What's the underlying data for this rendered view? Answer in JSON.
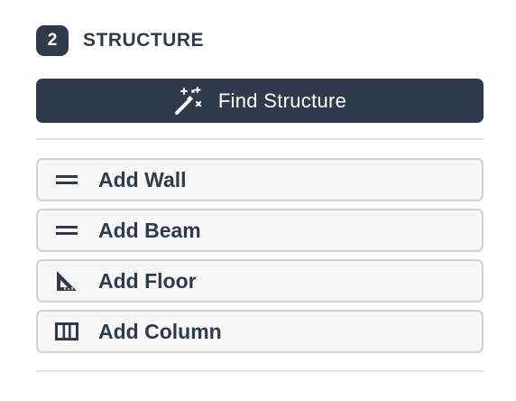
{
  "section": {
    "step_number": "2",
    "title": "STRUCTURE"
  },
  "primary_action": {
    "label": "Find Structure",
    "icon": "magic-wand-icon"
  },
  "tools": [
    {
      "label": "Add Wall",
      "icon": "equals-icon"
    },
    {
      "label": "Add Beam",
      "icon": "equals-icon"
    },
    {
      "label": "Add Floor",
      "icon": "set-square-icon"
    },
    {
      "label": "Add Column",
      "icon": "columns-icon"
    }
  ],
  "colors": {
    "primary": "#2f3a4d",
    "button_border": "#cfd2d7",
    "button_background": "#f7f7f8",
    "divider": "#e0e2e6"
  }
}
